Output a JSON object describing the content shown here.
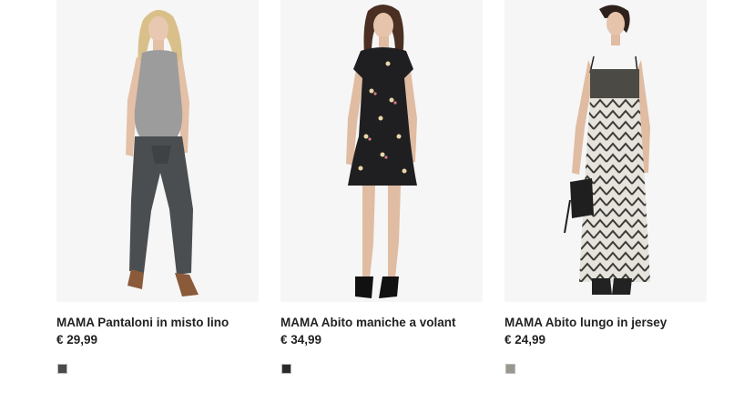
{
  "products": [
    {
      "title": "MAMA Pantaloni in misto lino",
      "price": "€ 29,99",
      "swatch_color": "#4a4a4d",
      "image_icon": "model-photo-trousers"
    },
    {
      "title": "MAMA Abito maniche a volant",
      "price": "€ 34,99",
      "swatch_color": "#2b2b2b",
      "image_icon": "model-photo-floral-dress"
    },
    {
      "title": "MAMA Abito lungo in jersey",
      "price": "€ 24,99",
      "swatch_color": "#9a9790",
      "image_icon": "model-photo-long-dress"
    }
  ]
}
